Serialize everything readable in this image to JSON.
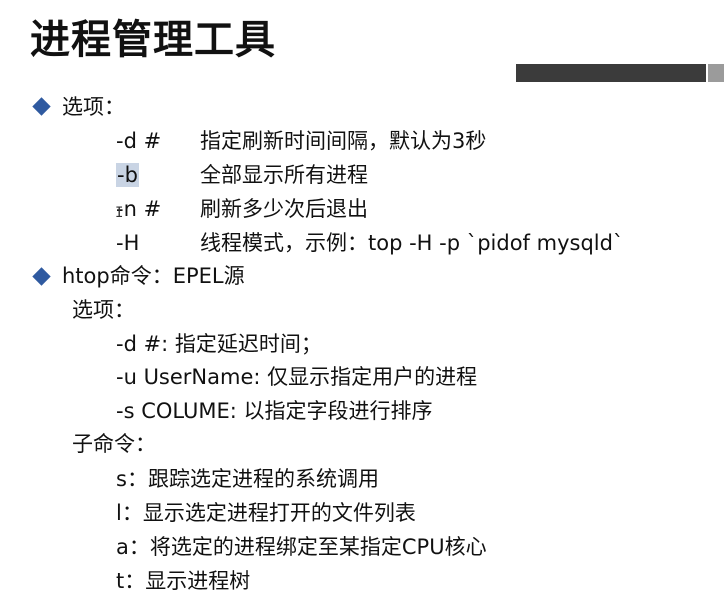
{
  "title": "进程管理工具",
  "section1": {
    "heading": "选项：",
    "options": [
      {
        "key": "-d #",
        "desc": "指定刷新时间间隔，默认为3秒"
      },
      {
        "key": "-b",
        "desc": "全部显示所有进程"
      },
      {
        "key": "-n #",
        "desc": "刷新多少次后退出"
      },
      {
        "key": "-H",
        "desc": "线程模式，示例：top -H -p `pidof mysqld`"
      }
    ]
  },
  "section2": {
    "heading": "htop命令：EPEL源",
    "options_label": "选项：",
    "options": [
      "-d #: 指定延迟时间；",
      "-u UserName: 仅显示指定用户的进程",
      "-s COLUME: 以指定字段进行排序"
    ],
    "subcommands_label": "子命令：",
    "subcommands": [
      "s：跟踪选定进程的系统调用",
      "l：显示选定进程打开的文件列表",
      "a：将选定的进程绑定至某指定CPU核心",
      "t：显示进程树"
    ]
  },
  "colors": {
    "bullet": "#2f5aa0",
    "selection_highlight": "#c9d4e4",
    "title_bar_dark": "#3b3b3b",
    "title_bar_light": "#9b9b9b"
  }
}
